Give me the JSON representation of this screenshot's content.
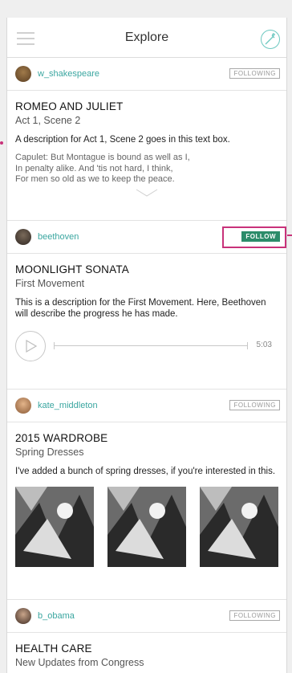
{
  "header": {
    "title": "Explore"
  },
  "posts": [
    {
      "user": "w_shakespeare",
      "follow": "FOLLOWING",
      "title": "ROMEO AND JULIET",
      "subtitle": "Act 1, Scene 2",
      "description": "A description for Act 1, Scene 2 goes in this text box.",
      "quote": [
        "Capulet: But Montague is bound as well as I,",
        "In penalty alike. And 'tis not hard, I think,",
        "For men so old as we to keep the peace."
      ]
    },
    {
      "user": "beethoven",
      "follow": "FOLLOW",
      "title": "MOONLIGHT SONATA",
      "subtitle": "First Movement",
      "description": "This is a description for the First Movement. Here, Beethoven will describe the progress he has made.",
      "duration": "5:03"
    },
    {
      "user": "kate_middleton",
      "follow": "FOLLOWING",
      "title": "2015 WARDROBE",
      "subtitle": "Spring Dresses",
      "description": "I've added a bunch of spring dresses, if you're interested in this."
    },
    {
      "user": "b_obama",
      "follow": "FOLLOWING",
      "title": "HEALTH CARE",
      "subtitle": "New Updates from Congress"
    }
  ],
  "colors": {
    "accent": "#3aa6a0",
    "follow_active": "#2c8c6a",
    "highlight": "#c8327a"
  }
}
